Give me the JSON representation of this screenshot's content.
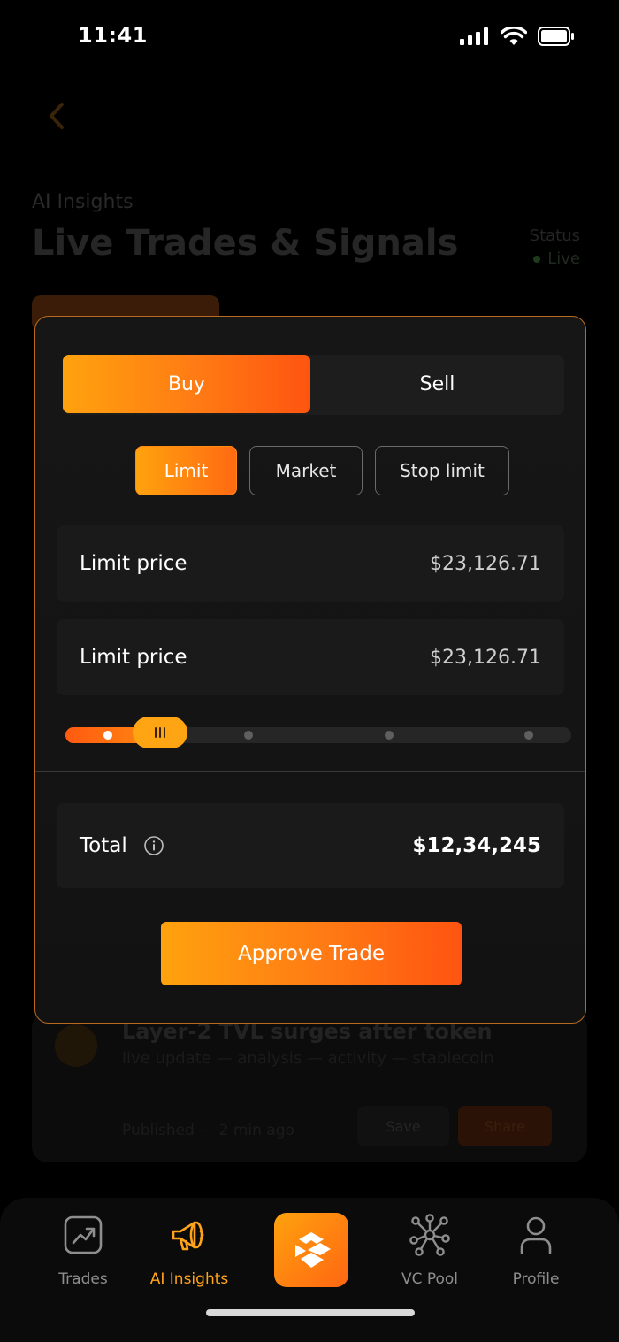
{
  "status_bar": {
    "time": "11:41"
  },
  "background": {
    "eyebrow": "AI Insights",
    "title": "Live Trades & Signals",
    "status_label": "Status",
    "status_value": "Live",
    "card_title": "Layer-2 TVL surges after token",
    "card_subtitle": "live update — analysis — activity — stablecoin",
    "card_meta": "Published — 2 min ago",
    "card_save": "Save",
    "card_share": "Share"
  },
  "trade_modal": {
    "side_buy": "Buy",
    "side_sell": "Sell",
    "active_side": "Buy",
    "order_types": [
      "Limit",
      "Market",
      "Stop limit"
    ],
    "active_order_type": "Limit",
    "fields": [
      {
        "label": "Limit price",
        "value": "$23,126.71"
      },
      {
        "label": "Limit price",
        "value": "$23,126.71"
      }
    ],
    "slider": {
      "value_fraction": 0.25,
      "steps": 5
    },
    "total_label": "Total",
    "total_value": "$12,34,245",
    "info_icon": "info-icon",
    "approve_label": "Approve Trade"
  },
  "tab_bar": {
    "tabs": [
      {
        "label": "Trades",
        "icon": "chart-trend-icon"
      },
      {
        "label": "AI Insights",
        "icon": "megaphone-icon"
      },
      {
        "label": "",
        "icon": "logo-icon"
      },
      {
        "label": "VC Pool",
        "icon": "network-icon"
      },
      {
        "label": "Profile",
        "icon": "user-icon"
      }
    ],
    "active_tab": "AI Insights"
  },
  "colors": {
    "accent": "#ff8a12",
    "accent_start": "#ffa20e",
    "accent_end": "#ff5410",
    "background": "#000000",
    "surface": "#1a1a1a"
  }
}
